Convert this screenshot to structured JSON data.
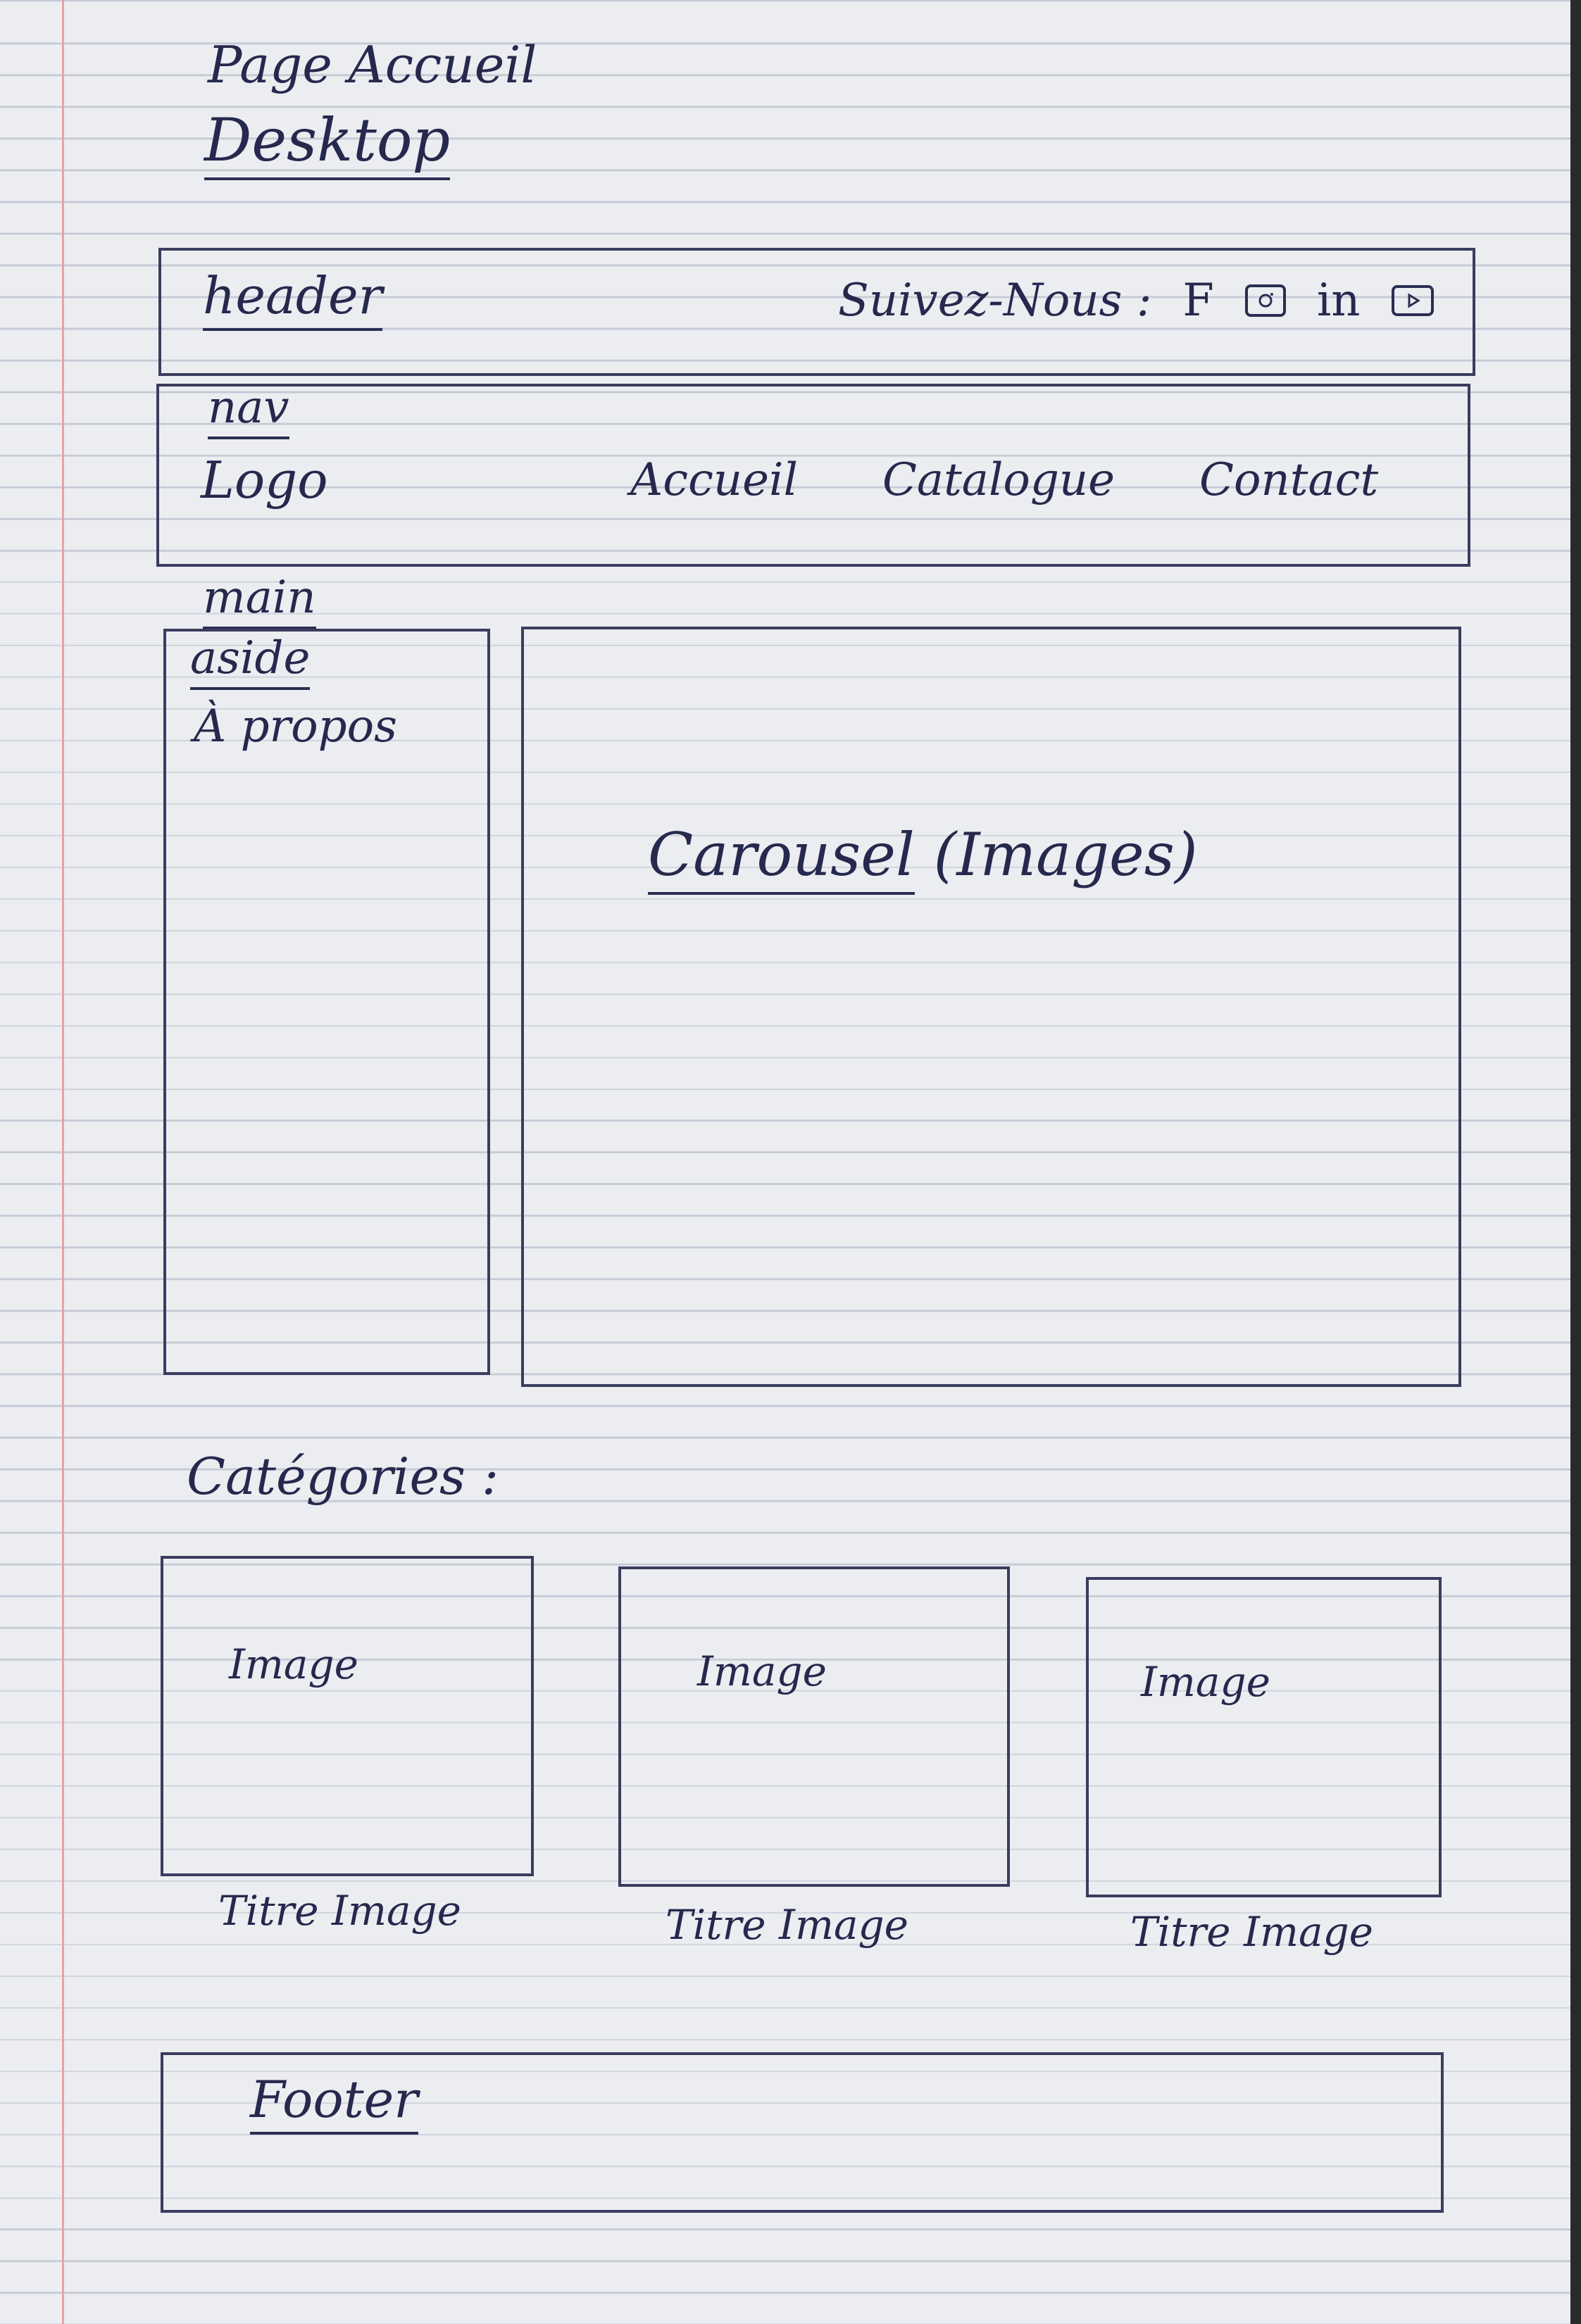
{
  "page": {
    "title": "Page Accueil",
    "subtitle": "Desktop"
  },
  "header": {
    "label": "header",
    "follow_text": "Suivez-Nous :",
    "social": {
      "facebook": "F",
      "linkedin": "in"
    }
  },
  "nav": {
    "label": "nav",
    "logo": "Logo",
    "links": [
      "Accueil",
      "Catalogue",
      "Contact"
    ]
  },
  "main": {
    "label": "main",
    "aside": {
      "label": "aside",
      "content": "À propos"
    },
    "carousel": {
      "title": "Carousel",
      "note": "(Images)"
    }
  },
  "categories": {
    "heading": "Catégories :",
    "items": [
      {
        "image": "Image",
        "caption": "Titre Image"
      },
      {
        "image": "Image",
        "caption": "Titre Image"
      },
      {
        "image": "Image",
        "caption": "Titre Image"
      }
    ]
  },
  "footer": {
    "label": "Footer"
  },
  "colors": {
    "ink": "#26294d",
    "paper": "#ecedf1",
    "rule": "#c4c8d4",
    "margin": "#e8a2a6"
  }
}
